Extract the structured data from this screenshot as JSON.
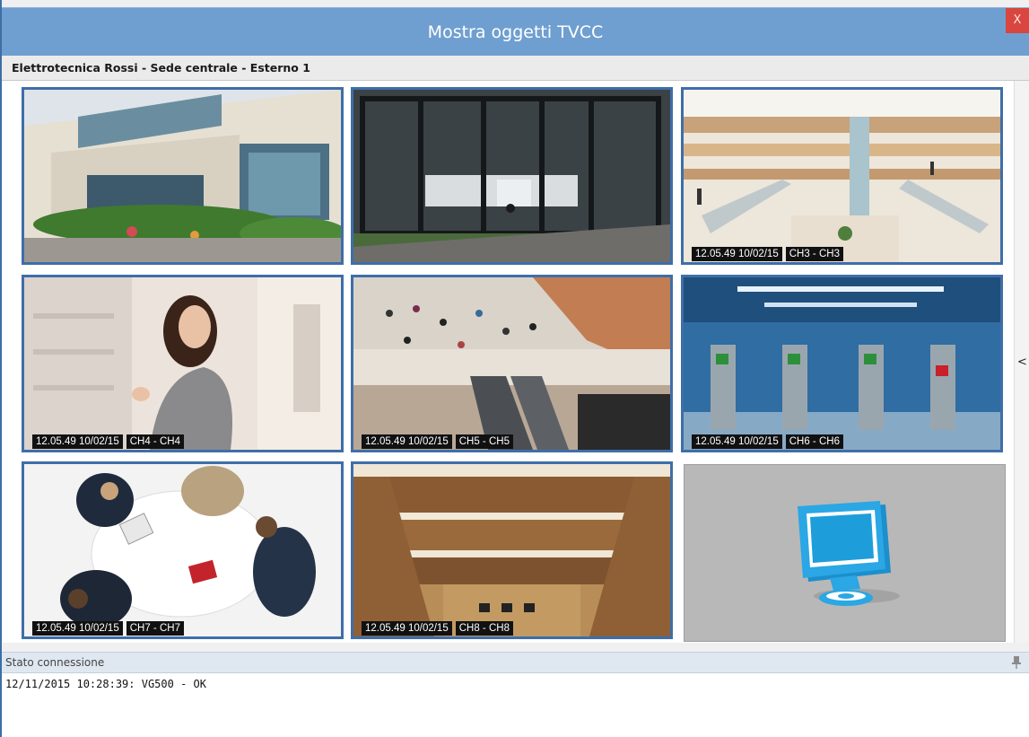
{
  "window": {
    "title": "Mostra oggetti TVCC",
    "close_label": "X"
  },
  "breadcrumb": "Elettrotecnica Rossi - Sede centrale - Esterno 1",
  "cameras": [
    {
      "time": "",
      "channel": ""
    },
    {
      "time": "",
      "channel": ""
    },
    {
      "time": "12.05.49 10/02/15",
      "channel": "CH3 - CH3"
    },
    {
      "time": "12.05.49 10/02/15",
      "channel": "CH4 - CH4"
    },
    {
      "time": "12.05.49 10/02/15",
      "channel": "CH5 - CH5"
    },
    {
      "time": "12.05.49 10/02/15",
      "channel": "CH6 - CH6"
    },
    {
      "time": "12.05.49 10/02/15",
      "channel": "CH7 - CH7"
    },
    {
      "time": "12.05.49 10/02/15",
      "channel": "CH8 - CH8"
    }
  ],
  "empty_slot_icon": "monitor-icon",
  "side_toggle": "<",
  "status": {
    "header": "Stato connessione",
    "log": "12/11/2015 10:28:39: VG500 - OK",
    "pin_icon": "pin-icon"
  },
  "colors": {
    "titlebar": "#6f9fd0",
    "tile_border": "#3f6ea8",
    "close": "#d9463f",
    "monitor": "#29a6e3"
  }
}
